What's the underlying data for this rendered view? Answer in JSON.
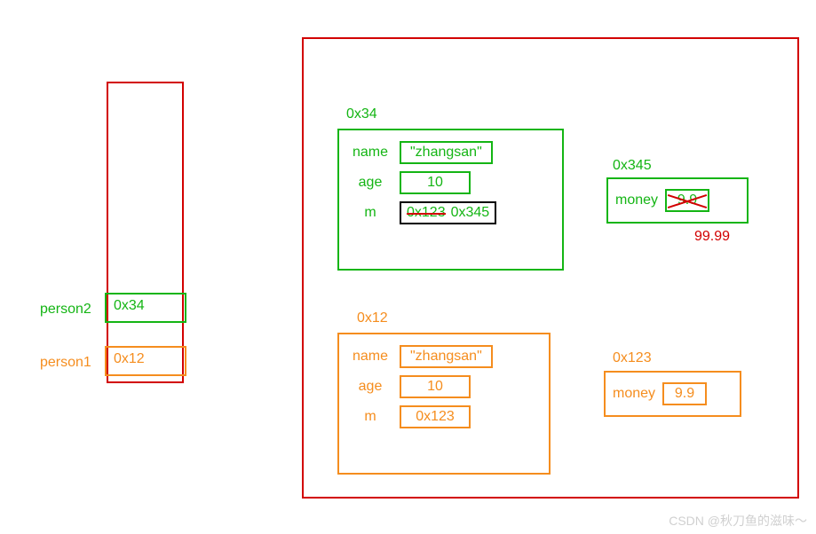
{
  "stack": {
    "person2": {
      "label": "person2",
      "value": "0x34"
    },
    "person1": {
      "label": "person1",
      "value": "0x12"
    }
  },
  "heap": {
    "obj34": {
      "address": "0x34",
      "fields": {
        "name": {
          "label": "name",
          "value": "\"zhangsan\""
        },
        "age": {
          "label": "age",
          "value": "10"
        },
        "m": {
          "label": "m",
          "old": "0x123",
          "new": "0x345"
        }
      }
    },
    "obj12": {
      "address": "0x12",
      "fields": {
        "name": {
          "label": "name",
          "value": "\"zhangsan\""
        },
        "age": {
          "label": "age",
          "value": "10"
        },
        "m": {
          "label": "m",
          "value": "0x123"
        }
      }
    },
    "money345": {
      "address": "0x345",
      "label": "money",
      "old": "9.9",
      "new": "99.99"
    },
    "money123": {
      "address": "0x123",
      "label": "money",
      "value": "9.9"
    }
  },
  "watermark": "CSDN @秋刀鱼的滋味～"
}
